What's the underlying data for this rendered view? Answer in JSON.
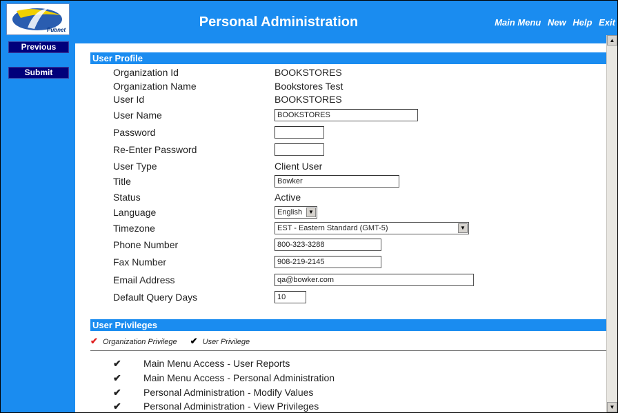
{
  "logo": {
    "text": "Pubnet"
  },
  "sidebar": {
    "previous_label": "Previous",
    "submit_label": "Submit"
  },
  "header": {
    "title": "Personal Administration"
  },
  "topnav": {
    "main_menu": "Main Menu",
    "new": "New",
    "help": "Help",
    "exit": "Exit"
  },
  "profile": {
    "section_title": "User Profile",
    "org_id": {
      "label": "Organization Id",
      "value": "BOOKSTORES"
    },
    "org_name": {
      "label": "Organization Name",
      "value": "Bookstores Test"
    },
    "user_id": {
      "label": "User Id",
      "value": "BOOKSTORES"
    },
    "user_name": {
      "label": "User Name",
      "value": "BOOKSTORES"
    },
    "password": {
      "label": "Password",
      "value": ""
    },
    "reenter_password": {
      "label": "Re-Enter Password",
      "value": ""
    },
    "user_type": {
      "label": "User Type",
      "value": "Client User"
    },
    "title": {
      "label": "Title",
      "value": "Bowker"
    },
    "status": {
      "label": "Status",
      "value": "Active"
    },
    "language": {
      "label": "Language",
      "value": "English"
    },
    "timezone": {
      "label": "Timezone",
      "value": "EST - Eastern Standard (GMT-5)"
    },
    "phone": {
      "label": "Phone Number",
      "value": "800-323-3288"
    },
    "fax": {
      "label": "Fax Number",
      "value": "908-219-2145"
    },
    "email": {
      "label": "Email Address",
      "value": "qa@bowker.com"
    },
    "query_days": {
      "label": "Default Query Days",
      "value": "10"
    }
  },
  "privileges": {
    "section_title": "User Privileges",
    "legend_org": "Organization Privilege",
    "legend_user": "User Privilege",
    "org_color": "#e02020",
    "user_color": "#000000",
    "items": [
      "Main Menu Access - User Reports",
      "Main Menu Access - Personal Administration",
      "Personal Administration - Modify Values",
      "Personal Administration - View Privileges"
    ]
  }
}
